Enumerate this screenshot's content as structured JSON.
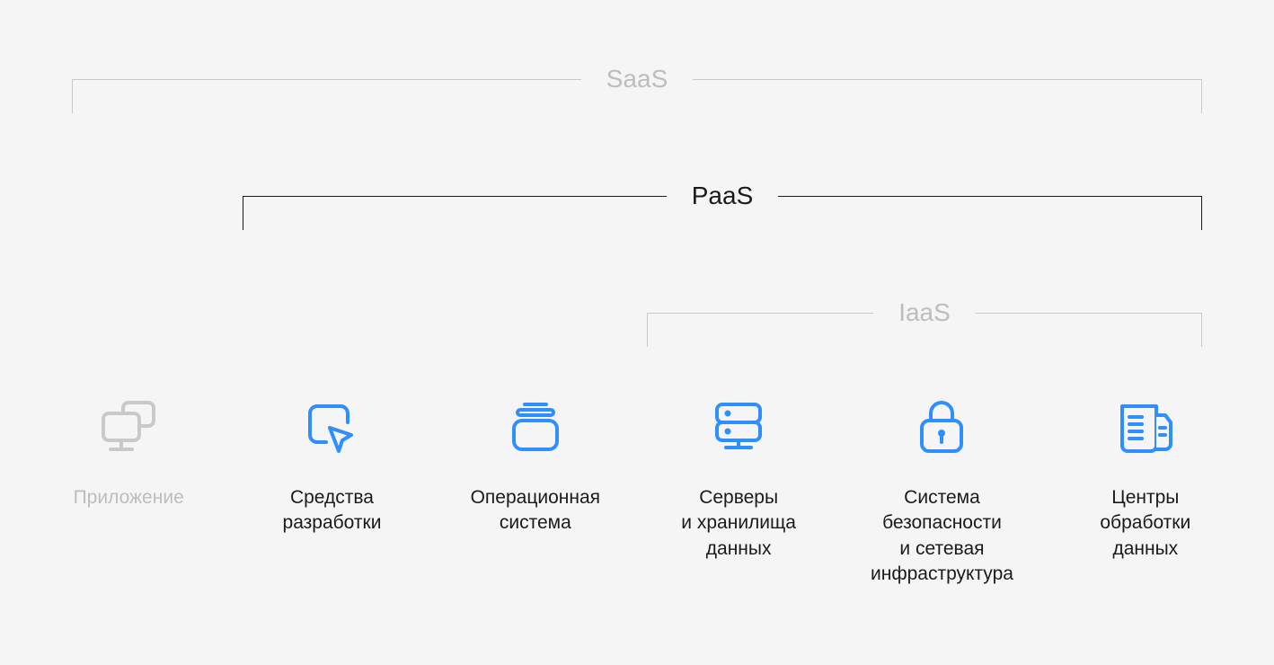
{
  "brackets": {
    "saas": {
      "label": "SaaS",
      "muted": true
    },
    "paas": {
      "label": "PaaS",
      "muted": false
    },
    "iaas": {
      "label": "IaaS",
      "muted": true
    }
  },
  "items": [
    {
      "key": "app",
      "label": "Приложение",
      "muted": true
    },
    {
      "key": "devtools",
      "label": "Средства\nразработки",
      "muted": false
    },
    {
      "key": "os",
      "label": "Операционная\nсистема",
      "muted": false
    },
    {
      "key": "servers",
      "label": "Серверы\nи хранилища\nданных",
      "muted": false
    },
    {
      "key": "security",
      "label": "Система\nбезопасности\nи сетевая\nинфраструктура",
      "muted": false
    },
    {
      "key": "datacenter",
      "label": "Центры\nобработки\nданных",
      "muted": false
    }
  ],
  "colors": {
    "accent": "#2f8fff",
    "muted": "#c9c9c9",
    "text": "#1a1a1a",
    "bg": "#f5f5f5"
  }
}
